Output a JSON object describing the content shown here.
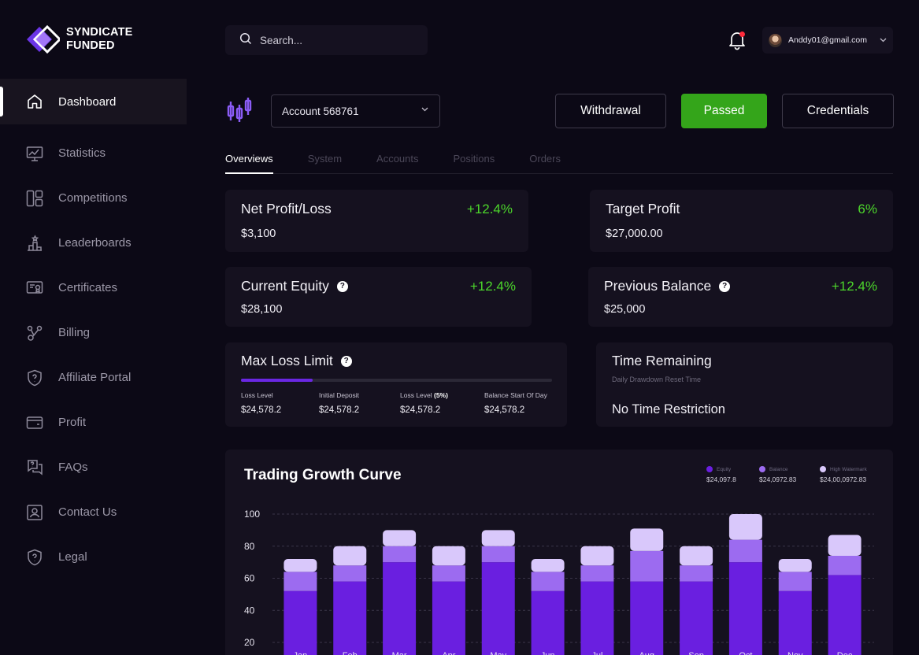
{
  "brand": {
    "line1": "SYNDICATE",
    "line2": "FUNDED"
  },
  "sidebar": {
    "items": [
      {
        "label": "Dashboard",
        "icon": "home-icon",
        "active": true
      },
      {
        "label": "Statistics",
        "icon": "statistics-icon"
      },
      {
        "label": "Competitions",
        "icon": "competitions-icon"
      },
      {
        "label": "Leaderboards",
        "icon": "leaderboard-icon"
      },
      {
        "label": "Certificates",
        "icon": "certificate-icon"
      },
      {
        "label": "Billing",
        "icon": "billing-icon"
      },
      {
        "label": "Affiliate Portal",
        "icon": "shield-icon"
      },
      {
        "label": "Profit",
        "icon": "wallet-icon"
      },
      {
        "label": "FAQs",
        "icon": "faq-icon"
      },
      {
        "label": "Contact Us",
        "icon": "contact-icon"
      },
      {
        "label": "Legal",
        "icon": "shield-icon"
      }
    ]
  },
  "header": {
    "search_placeholder": "Search...",
    "user_email": "Anddy01@gmail.com",
    "notification_color": "#ff2a3b"
  },
  "account": {
    "selected": "Account 568761",
    "withdraw_label": "Withdrawal",
    "status_label": "Passed",
    "credentials_label": "Credentials",
    "status_color": "#34a51a"
  },
  "tabs": [
    "Overviews",
    "System",
    "Accounts",
    "Positions",
    "Orders"
  ],
  "cards": {
    "net_profit": {
      "title": "Net Profit/Loss",
      "value": "$3,100",
      "change": "+12.4%"
    },
    "target_profit": {
      "title": "Target Profit",
      "value": "$27,000.00",
      "change": "6%"
    },
    "current_equity": {
      "title": "Current Equity",
      "value": "$28,100",
      "change": "+12.4%"
    },
    "previous_balance": {
      "title": "Previous Balance",
      "value": "$25,000",
      "change": "+12.4%"
    },
    "max_loss": {
      "title": "Max Loss Limit",
      "progress": 0.23,
      "stats": [
        {
          "label": "Loss Level",
          "bold": "",
          "value": "$24,578.2"
        },
        {
          "label": "Initial Deposit",
          "bold": "",
          "value": "$24,578.2"
        },
        {
          "label": "Loss Level ",
          "bold": "(5%)",
          "value": "$24,578.2"
        },
        {
          "label": "Balance Start Of Day",
          "bold": "",
          "value": "$24,578.2"
        }
      ]
    },
    "time_remaining": {
      "title": "Time Remaining",
      "subtitle": "Daily Drawdown Reset Time",
      "value": "No Time Restriction"
    }
  },
  "chart_data": {
    "type": "bar",
    "title": "Trading Growth Curve",
    "stacked": true,
    "categories": [
      "Jan",
      "Feb",
      "Mar",
      "Apr",
      "May",
      "Jun",
      "Jul",
      "Aug",
      "Sep",
      "Oct",
      "Nov",
      "Dec"
    ],
    "series": [
      {
        "name": "Equity",
        "color": "#6a1fe0",
        "values": [
          52,
          58,
          70,
          58,
          70,
          52,
          58,
          58,
          58,
          70,
          52,
          62
        ]
      },
      {
        "name": "Balance",
        "color": "#9c6bf0",
        "values": [
          12,
          10,
          10,
          10,
          10,
          12,
          10,
          19,
          10,
          14,
          12,
          12
        ]
      },
      {
        "name": "High Watermark",
        "color": "#d9c8fb",
        "values": [
          8,
          12,
          10,
          12,
          10,
          8,
          12,
          14,
          12,
          16,
          8,
          13
        ]
      }
    ],
    "legend_values": [
      "$24,097.8",
      "$24,0972.83",
      "$24,00,0972.83"
    ],
    "yticks": [
      20,
      40,
      60,
      80,
      100
    ],
    "ylim": [
      20,
      100
    ],
    "grid": true,
    "legend_position": "top-right"
  }
}
